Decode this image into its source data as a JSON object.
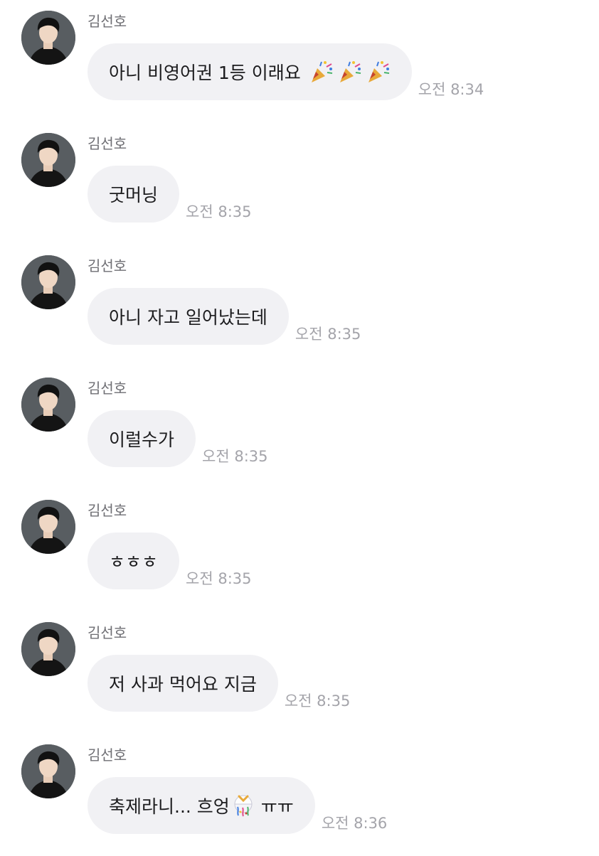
{
  "messages": [
    {
      "sender": "김선호",
      "text": "아니 비영어권 1등 이래요",
      "emojis": [
        "party-popper",
        "party-popper",
        "party-popper"
      ],
      "time": "오전 8:34"
    },
    {
      "sender": "김선호",
      "text": "굿머닝",
      "time": "오전 8:35"
    },
    {
      "sender": "김선호",
      "text": "아니 자고 일어났는데",
      "time": "오전 8:35"
    },
    {
      "sender": "김선호",
      "text": "이럴수가",
      "time": "오전 8:35"
    },
    {
      "sender": "김선호",
      "text": "ㅎㅎㅎ",
      "time": "오전 8:35"
    },
    {
      "sender": "김선호",
      "text": "저 사과 먹어요 지금",
      "time": "오전 8:35"
    },
    {
      "sender": "김선호",
      "text": "축제라니... 흐엉",
      "emojis": [
        "confetti-ball"
      ],
      "text_after": "ㅠㅠ",
      "time": "오전 8:36"
    }
  ],
  "colors": {
    "bubble": "#f1f1f4",
    "text": "#1c1c1e",
    "sender": "#6e6e73",
    "time": "#a4a4aa"
  }
}
